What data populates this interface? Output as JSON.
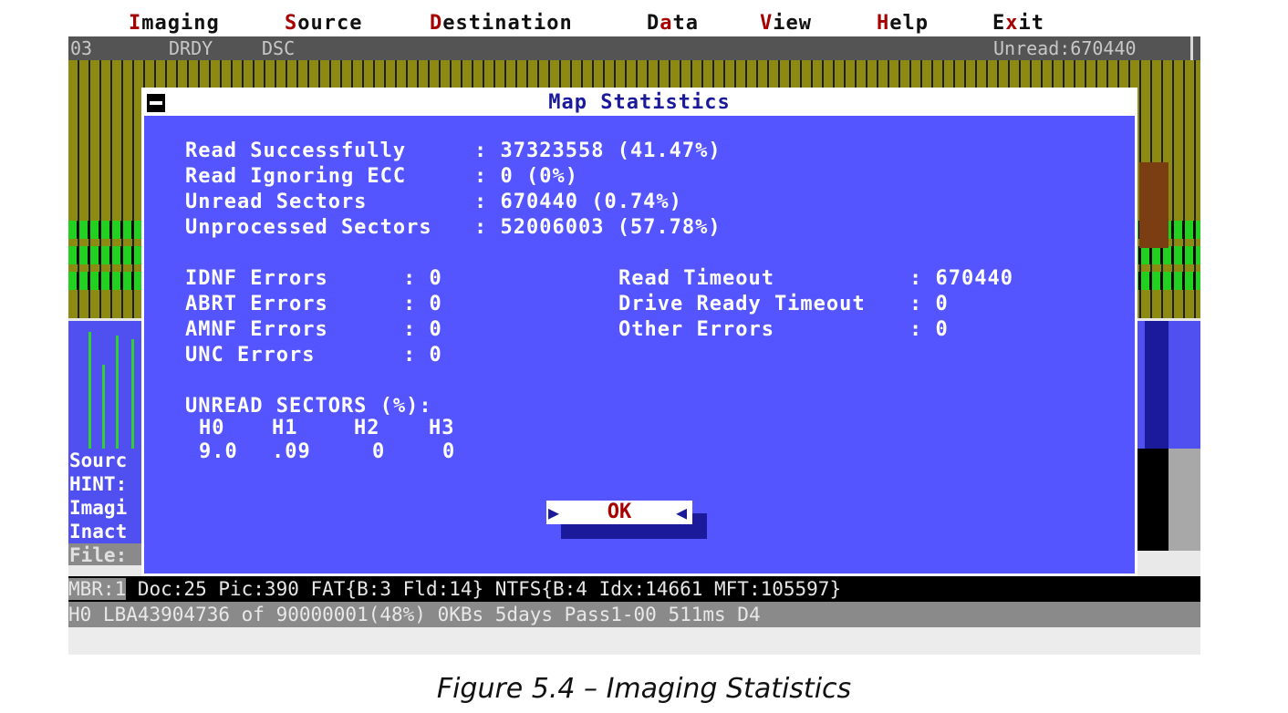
{
  "menu": {
    "items": [
      {
        "hot": "I",
        "rest": "maging"
      },
      {
        "hot": "S",
        "rest": "ource"
      },
      {
        "hot": "D",
        "rest": "estination"
      },
      {
        "pre": "D",
        "hot": "a",
        "rest": "ta"
      },
      {
        "hot": "V",
        "rest": "iew"
      },
      {
        "hot": "H",
        "rest": "elp"
      },
      {
        "pre": "E",
        "hot": "x",
        "rest": "it"
      }
    ]
  },
  "status": {
    "left": "03",
    "drdy": "DRDY",
    "dsc": "DSC",
    "unread": "Unread:670440"
  },
  "side_text": [
    "Sourc",
    "HINT:",
    "Imagi",
    "Inact",
    "File:"
  ],
  "bottom": {
    "mbr_label": "MBR:1",
    "mbr_info": " Doc:25 Pic:390 FAT{B:3 Fld:14} NTFS{B:4 Idx:14661 MFT:105597}",
    "h0_line": "H0 LBA43904736 of 90000001(48%) 0KBs 5days Pass1-00 511ms D4"
  },
  "dialog": {
    "title": "Map Statistics",
    "read_stats": [
      {
        "label": "Read Successfully    ",
        "value": ": 37323558 (41.47%)"
      },
      {
        "label": "Read Ignoring ECC    ",
        "value": ": 0 (0%)"
      },
      {
        "label": "Unread Sectors       ",
        "value": ": 670440 (0.74%)"
      },
      {
        "label": "Unprocessed Sectors ",
        "value": ": 52006003 (57.78%)"
      }
    ],
    "errors_left": [
      {
        "label": "IDNF Errors",
        "value": ": 0"
      },
      {
        "label": "ABRT Errors",
        "value": ": 0"
      },
      {
        "label": "AMNF Errors",
        "value": ": 0"
      },
      {
        "label": "UNC Errors",
        "value": ": 0"
      }
    ],
    "errors_right": [
      {
        "label": "Read Timeout",
        "value": ": 670440"
      },
      {
        "label": "Drive Ready Timeout",
        "value": ": 0"
      },
      {
        "label": "Other Errors",
        "value": ": 0"
      }
    ],
    "unread_heading": "UNREAD SECTORS (%):",
    "heads": [
      "H0",
      "H1",
      "H2",
      "H3"
    ],
    "head_values": [
      "9.0",
      ".09",
      "0",
      "0"
    ],
    "ok_label": "OK"
  },
  "caption": "Figure 5.4 – Imaging Statistics",
  "colors": {
    "dialog_bg": "#5555ff",
    "hotkey": "#a80000",
    "ok_text": "#a80000",
    "map_yellow": "#8c8a10",
    "map_green": "#22d022"
  }
}
